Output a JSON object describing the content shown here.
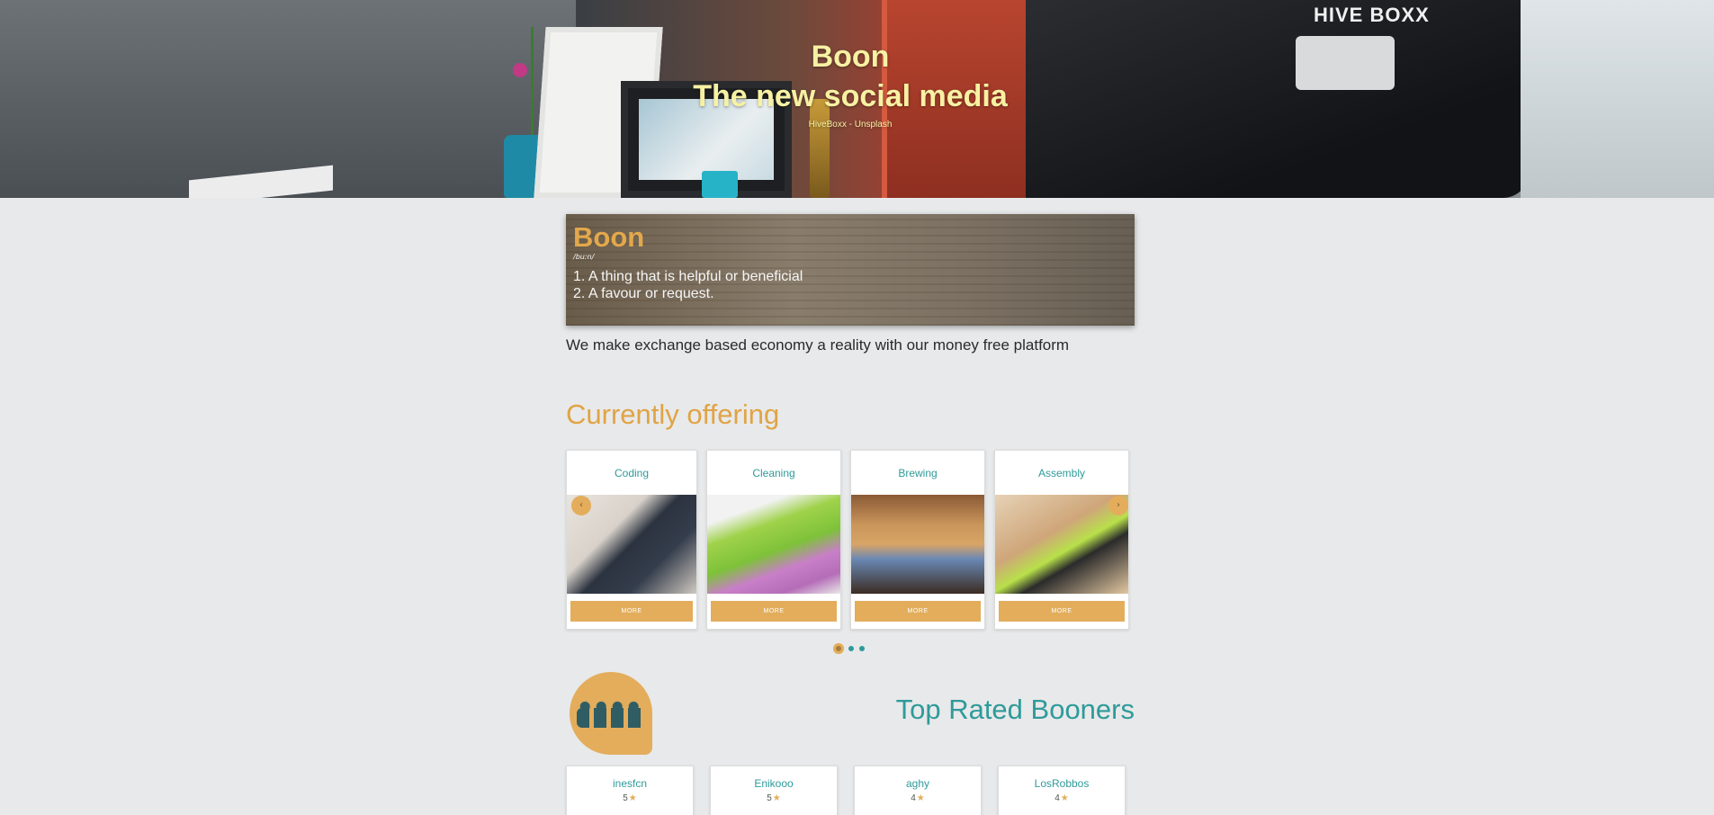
{
  "hero": {
    "title": "Boon",
    "subtitle": "The new social media",
    "credit": "HiveBoxx - Unsplash",
    "box_brand": "HIVE BOXX"
  },
  "definition": {
    "word": "Boon",
    "phonetic": "/buːn/",
    "meaning_1": "1. A thing that is helpful or beneficial",
    "meaning_2": "2. A favour or request."
  },
  "tagline": "We make exchange based economy a reality with our money free platform",
  "offering": {
    "title": "Currently offering",
    "cards": [
      {
        "category": "Coding",
        "button": "MORE"
      },
      {
        "category": "Cleaning",
        "button": "MORE"
      },
      {
        "category": "Brewing",
        "button": "MORE"
      },
      {
        "category": "Assembly",
        "button": "MORE"
      }
    ],
    "prev_icon": "chevron-left-icon",
    "next_icon": "chevron-right-icon",
    "prev_glyph": "‹",
    "next_glyph": "›",
    "pagination": {
      "pages": 3,
      "active": 1
    }
  },
  "top_rated": {
    "title": "Top Rated Booners",
    "users": [
      {
        "name": "inesfcn",
        "rating": "5"
      },
      {
        "name": "Enikooo",
        "rating": "5"
      },
      {
        "name": "aghy",
        "rating": "4"
      },
      {
        "name": "LosRobbos",
        "rating": "4"
      }
    ],
    "star_glyph": "★"
  },
  "colors": {
    "accent": "#e3ad5c",
    "teal": "#2f9a9a",
    "hero_text": "#f7f1a3",
    "background": "#e8e9ea"
  }
}
